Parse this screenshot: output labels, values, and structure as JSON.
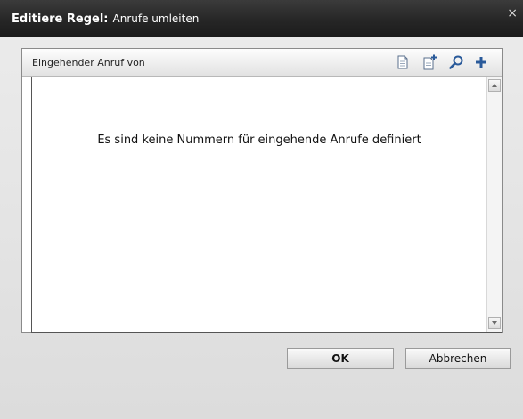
{
  "dialog": {
    "title_bold": "Editiere Regel:",
    "title_rest": "Anrufe umleiten",
    "close_glyph": "×"
  },
  "panel": {
    "header_label": "Eingehender Anruf von",
    "toolbar_icons": [
      "document-icon",
      "new-document-icon",
      "search-icon",
      "add-icon"
    ],
    "empty_message": "Es sind keine Nummern für eingehende Anrufe definiert"
  },
  "buttons": {
    "ok_label": "OK",
    "cancel_label": "Abbrechen"
  },
  "colors": {
    "titlebar": "#262626",
    "toolbar_icon": "#2a5a9a"
  }
}
